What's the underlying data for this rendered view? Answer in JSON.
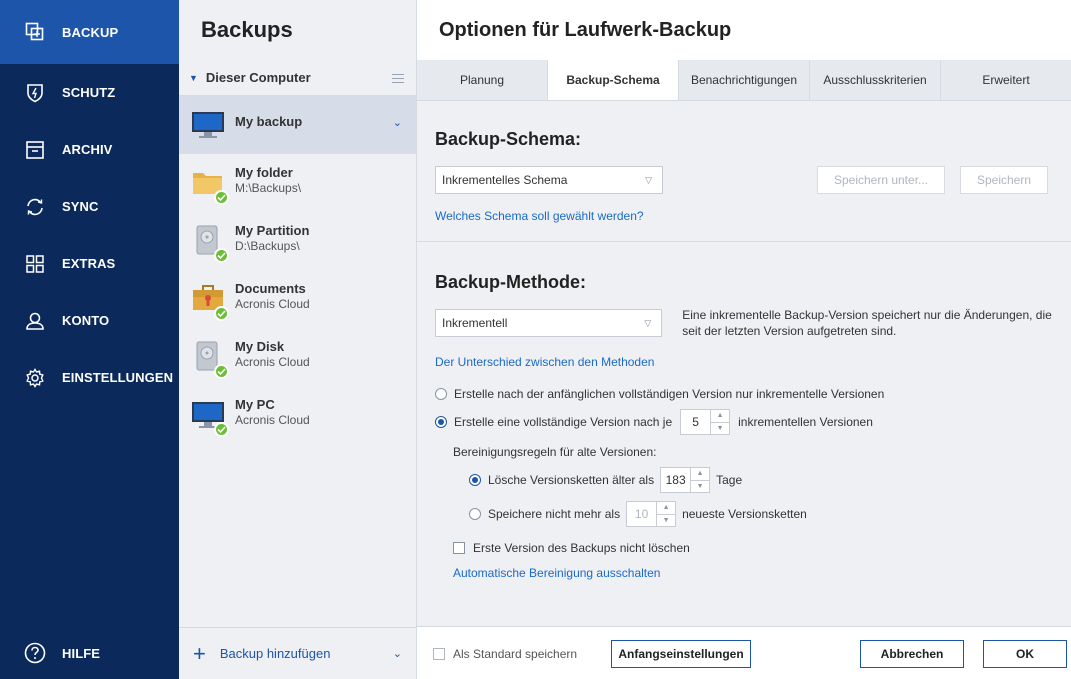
{
  "sidebar": {
    "items": [
      {
        "label": "BACKUP",
        "icon": "backup-copy-icon"
      },
      {
        "label": "SCHUTZ",
        "icon": "shield-icon"
      },
      {
        "label": "ARCHIV",
        "icon": "archive-box-icon"
      },
      {
        "label": "SYNC",
        "icon": "sync-icon"
      },
      {
        "label": "EXTRAS",
        "icon": "grid-icon"
      },
      {
        "label": "KONTO",
        "icon": "user-icon"
      },
      {
        "label": "EINSTELLUNGEN",
        "icon": "gear-icon"
      }
    ],
    "help_label": "HILFE"
  },
  "backups": {
    "title": "Backups",
    "group_label": "Dieser Computer",
    "items": [
      {
        "name": "My backup",
        "path": ""
      },
      {
        "name": "My folder",
        "path": "M:\\Backups\\"
      },
      {
        "name": "My Partition",
        "path": "D:\\Backups\\"
      },
      {
        "name": "Documents",
        "path": "Acronis Cloud"
      },
      {
        "name": "My Disk",
        "path": "Acronis Cloud"
      },
      {
        "name": "My PC",
        "path": "Acronis Cloud"
      }
    ],
    "add_label": "Backup hinzufügen"
  },
  "main": {
    "title": "Optionen für Laufwerk-Backup",
    "tabs": [
      "Planung",
      "Backup-Schema",
      "Benachrichtigungen",
      "Ausschlusskriterien",
      "Erweitert"
    ],
    "schema": {
      "title": "Backup-Schema:",
      "dropdown_value": "Inkrementelles Schema",
      "save_as_label": "Speichern unter...",
      "save_label": "Speichern",
      "help_link": "Welches Schema soll gewählt werden?"
    },
    "method": {
      "title": "Backup-Methode:",
      "dropdown_value": "Inkrementell",
      "description": "Eine inkrementelle Backup-Version speichert nur die Änderungen, die seit der letzten Version aufgetreten sind.",
      "diff_link": "Der Unterschied zwischen den Methoden",
      "option1": "Erstelle nach der anfänglichen vollständigen Version nur inkrementelle Versionen",
      "option2_prefix": "Erstelle eine vollständige Version nach je",
      "option2_value": "5",
      "option2_suffix": "inkrementellen Versionen",
      "cleanup_label": "Bereinigungsregeln für alte Versionen:",
      "cleanup1_prefix": "Lösche Versionsketten älter als",
      "cleanup1_value": "183",
      "cleanup1_suffix": "Tage",
      "cleanup2_prefix": "Speichere nicht mehr als",
      "cleanup2_value": "10",
      "cleanup2_suffix": "neueste Versionsketten",
      "keep_first_label": "Erste Version des Backups nicht löschen",
      "auto_cleanup_link": "Automatische Bereinigung ausschalten"
    },
    "footer": {
      "default_label": "Als Standard speichern",
      "initial_label": "Anfangseinstellungen",
      "cancel_label": "Abbrechen",
      "ok_label": "OK"
    }
  },
  "colors": {
    "sidebar_bg": "#0b2a5b",
    "sidebar_active": "#1c55aa",
    "accent": "#1c55aa",
    "link": "#1c6ac7",
    "success": "#6bbf35"
  }
}
